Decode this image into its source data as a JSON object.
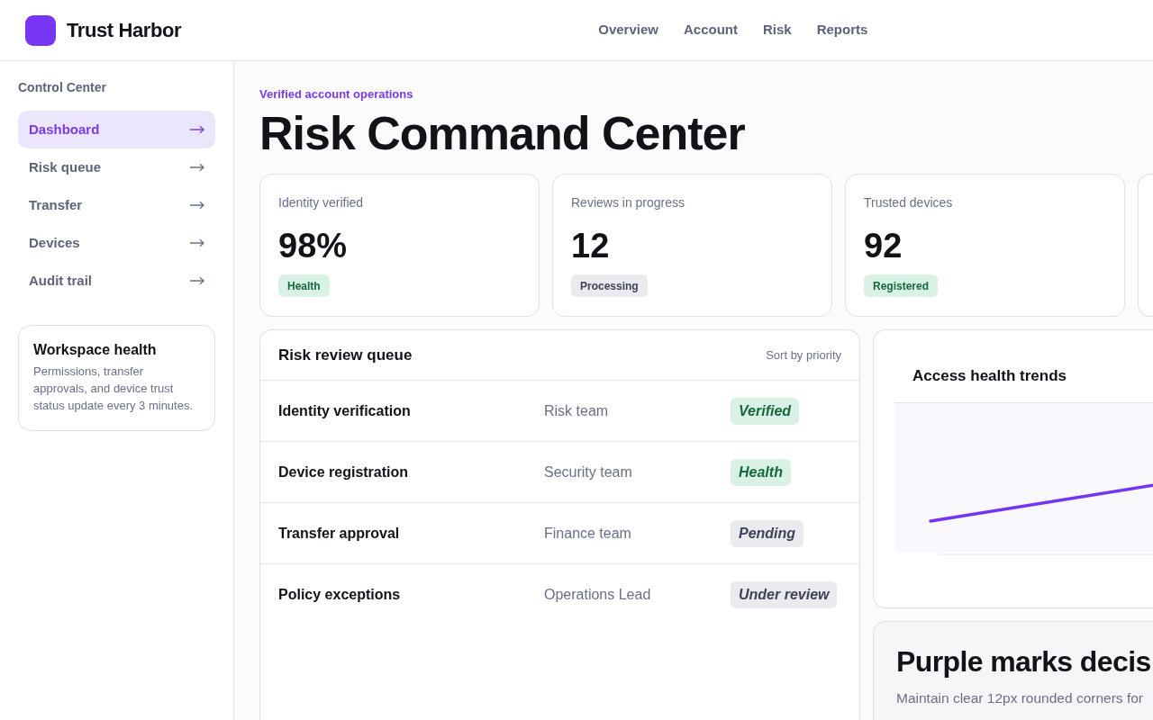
{
  "header": {
    "brand": "Trust Harbor",
    "nav": [
      "Overview",
      "Account",
      "Risk",
      "Reports"
    ]
  },
  "sidebar": {
    "section_title": "Control Center",
    "items": [
      {
        "label": "Dashboard",
        "selected": true
      },
      {
        "label": "Risk queue",
        "selected": false
      },
      {
        "label": "Transfer",
        "selected": false
      },
      {
        "label": "Devices",
        "selected": false
      },
      {
        "label": "Audit trail",
        "selected": false
      }
    ],
    "info_card": {
      "title": "Workspace health",
      "body": "Permissions, transfer approvals, and device trust status update every 3 minutes."
    }
  },
  "page": {
    "eyebrow": "Verified account operations",
    "title": "Risk Command Center"
  },
  "stats": [
    {
      "label": "Identity verified",
      "value": "98%",
      "badge": {
        "label": "Health",
        "kind": "success"
      }
    },
    {
      "label": "Reviews in progress",
      "value": "12",
      "badge": {
        "label": "Processing",
        "kind": "neutral"
      }
    },
    {
      "label": "Trusted devices",
      "value": "92",
      "badge": {
        "label": "Registered",
        "kind": "success"
      }
    }
  ],
  "queue": {
    "title": "Risk review queue",
    "sort_label": "Sort by priority",
    "rows": [
      {
        "name": "Identity verification",
        "team": "Risk team",
        "status": {
          "label": "Verified",
          "kind": "success"
        }
      },
      {
        "name": "Device registration",
        "team": "Security team",
        "status": {
          "label": "Health",
          "kind": "success"
        }
      },
      {
        "name": "Transfer approval",
        "team": "Finance team",
        "status": {
          "label": "Pending",
          "kind": "neutral"
        }
      },
      {
        "name": "Policy exceptions",
        "team": "Operations Lead",
        "status": {
          "label": "Under review",
          "kind": "neutral"
        }
      }
    ]
  },
  "chart_panel": {
    "title": "Access health trends"
  },
  "note": {
    "title": "Purple marks decis",
    "body": "Maintain clear 12px rounded corners for"
  }
}
